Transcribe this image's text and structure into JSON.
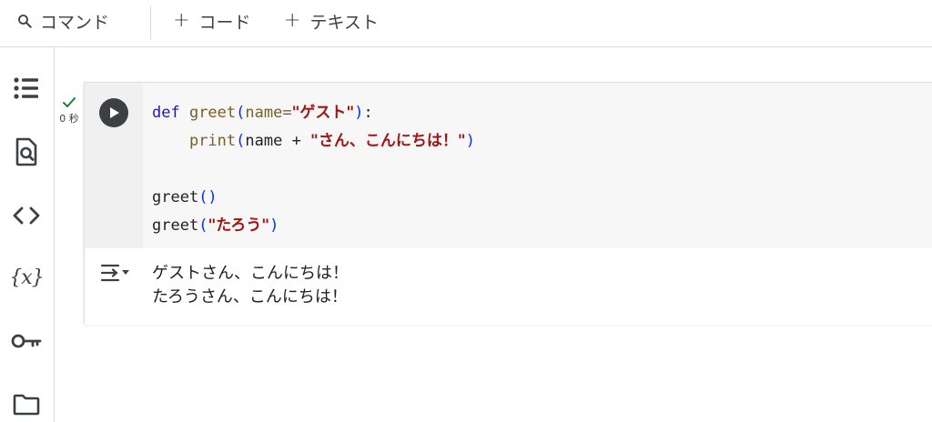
{
  "toolbar": {
    "command_label": "コマンド",
    "code_label": "コード",
    "text_label": "テキスト",
    "plus": "+"
  },
  "sidebar": {
    "items": [
      {
        "icon": "table-of-contents-icon"
      },
      {
        "icon": "find-replace-icon"
      },
      {
        "icon": "code-snippets-icon"
      },
      {
        "icon": "variables-icon",
        "glyph": "{x}"
      },
      {
        "icon": "secrets-key-icon"
      },
      {
        "icon": "files-folder-icon"
      }
    ]
  },
  "cell": {
    "exec_status": "success",
    "exec_time": "0 秒",
    "code": {
      "line1": {
        "def": "def ",
        "fn": "greet",
        "open": "(",
        "param": "name=",
        "str": "\"ゲスト\"",
        "close": ")",
        "colon": ":"
      },
      "line2": {
        "indent": "    ",
        "fn": "print",
        "open": "(",
        "expr": "name + ",
        "str": "\"さん、こんにちは！\"",
        "close": ")"
      },
      "line4": {
        "fn": "greet",
        "parens": "()"
      },
      "line5": {
        "fn": "greet",
        "open": "(",
        "str": "\"たろう\"",
        "close": ")"
      }
    },
    "output": [
      "ゲストさん、こんにちは！",
      "たろうさん、こんにちは！"
    ]
  },
  "colors": {
    "keyword": "#1a1aa6",
    "function": "#795e26",
    "paren": "#0431fa",
    "string": "#a31515",
    "check": "#188038",
    "run_button": "#3c4043"
  }
}
